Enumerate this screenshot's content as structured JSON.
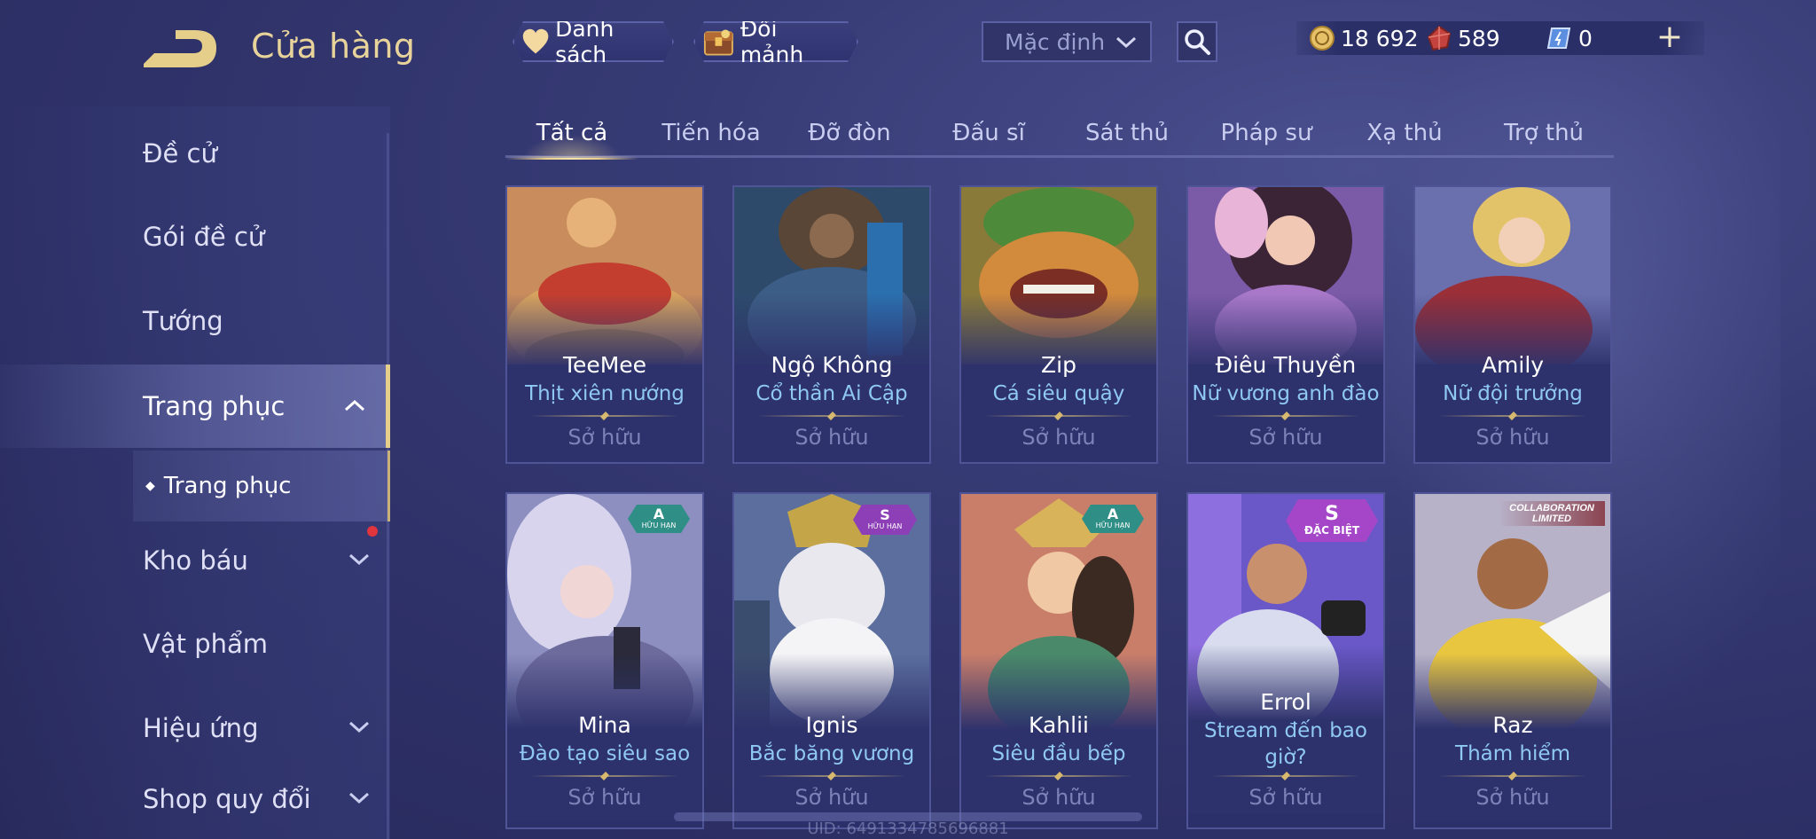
{
  "header": {
    "title": "Cửa hàng",
    "list_btn": "Danh sách",
    "shard_btn": "Đổi mảnh",
    "sort_value": "Mặc định",
    "gold": "18 692",
    "ruby": "589",
    "voucher": "0"
  },
  "sidebar": {
    "items": [
      "Đề cử",
      "Gói đề cử",
      "Tướng",
      "Trang phục",
      "Kho báu",
      "Vật phẩm",
      "Hiệu ứng",
      "Shop quy đổi"
    ],
    "active_sub": "Trang phục"
  },
  "tabs": [
    "Tất cả",
    "Tiến hóa",
    "Đỡ đòn",
    "Đấu sĩ",
    "Sát thủ",
    "Pháp sư",
    "Xạ thủ",
    "Trợ thủ"
  ],
  "owned_label": "Sở hữu",
  "cards": [
    {
      "hero": "TeeMee",
      "skin": "Thịt xiên nướng"
    },
    {
      "hero": "Ngộ Không",
      "skin": "Cổ thần Ai Cập"
    },
    {
      "hero": "Zip",
      "skin": "Cá siêu quậy"
    },
    {
      "hero": "Điêu Thuyền",
      "skin": "Nữ vương anh đào"
    },
    {
      "hero": "Amily",
      "skin": "Nữ đội trưởng"
    },
    {
      "hero": "Mina",
      "skin": "Đào tạo siêu sao",
      "badge": {
        "letter": "A",
        "sub": "HỮU HẠN"
      }
    },
    {
      "hero": "Ignis",
      "skin": "Bắc băng vương",
      "badge": {
        "letter": "S",
        "sub": "HỮU HẠN"
      }
    },
    {
      "hero": "Kahlii",
      "skin": "Siêu đầu bếp",
      "badge": {
        "letter": "A",
        "sub": "HỮU HẠN"
      }
    },
    {
      "hero": "Errol",
      "skin": "Stream đến bao giờ?",
      "badge": {
        "letter": "S",
        "sub": "ĐẶC BIỆT"
      }
    },
    {
      "hero": "Raz",
      "skin": "Thám hiểm",
      "badge": {
        "line1": "COLLABORATION",
        "line2": "LIMITED"
      }
    }
  ],
  "uid": "UID: 6491334785696881",
  "colors": {
    "accent_gold": "#e5cd8a",
    "skin_name": "#8fc8f3",
    "owned": "#7d82b8",
    "badge_a": "#2f8e86",
    "badge_s": "#8c3fb7"
  }
}
